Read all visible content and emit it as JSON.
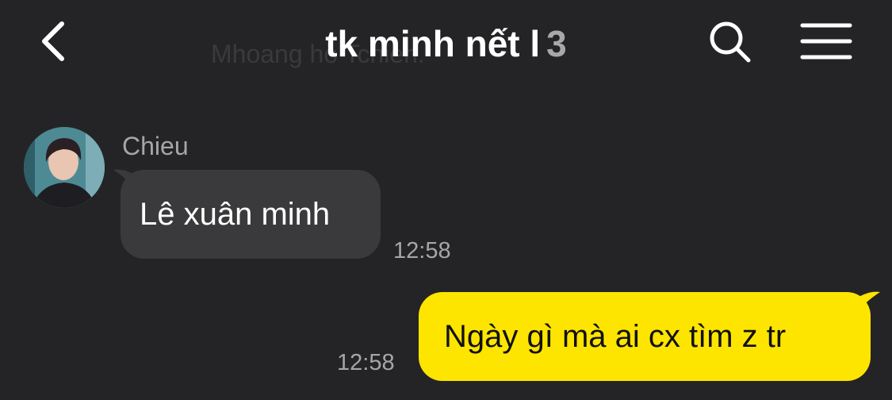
{
  "header": {
    "title": "tk minh nết l",
    "member_count": "3",
    "ghost_text": "Mhoang            ho Tchien.",
    "back_icon": "chevron-left-icon",
    "search_icon": "search-icon",
    "menu_icon": "hamburger-menu-icon"
  },
  "messages": [
    {
      "direction": "incoming",
      "sender": "Chieu",
      "text": "Lê xuân minh",
      "time": "12:58"
    },
    {
      "direction": "outgoing",
      "text": "Ngày gì mà ai cx tìm z tr",
      "time": "12:58"
    }
  ],
  "colors": {
    "background": "#242426",
    "incoming_bubble": "#3a3a3c",
    "outgoing_bubble": "#fee500",
    "muted_text": "#a6a6a9"
  }
}
